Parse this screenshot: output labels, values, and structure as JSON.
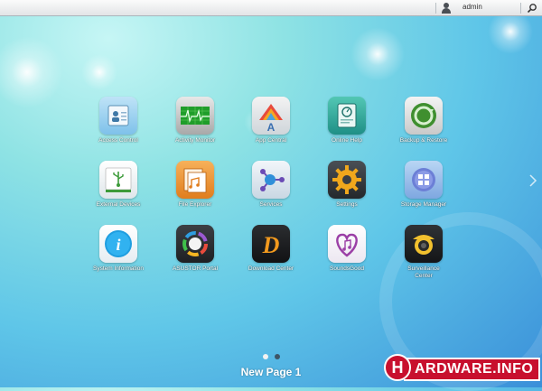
{
  "topbar": {
    "username": "admin",
    "user_icon": "user-icon",
    "search_icon": "search-icon"
  },
  "apps": [
    {
      "label": "Access Control",
      "icon": "access-control-icon"
    },
    {
      "label": "Activity Monitor",
      "icon": "activity-monitor-icon"
    },
    {
      "label": "App Central",
      "icon": "app-central-icon"
    },
    {
      "label": "Online Help",
      "icon": "online-help-icon"
    },
    {
      "label": "Backup & Restore",
      "icon": "backup-restore-icon"
    },
    {
      "label": "External Devices",
      "icon": "external-devices-icon"
    },
    {
      "label": "File Explorer",
      "icon": "file-explorer-icon"
    },
    {
      "label": "Services",
      "icon": "services-icon"
    },
    {
      "label": "Settings",
      "icon": "settings-icon"
    },
    {
      "label": "Storage Manager",
      "icon": "storage-manager-icon"
    },
    {
      "label": "System Information",
      "icon": "system-information-icon"
    },
    {
      "label": "ASUSTOR Portal",
      "icon": "asustor-portal-icon"
    },
    {
      "label": "Download Center",
      "icon": "download-center-icon"
    },
    {
      "label": "SoundsGood",
      "icon": "soundsgood-icon"
    },
    {
      "label": "Surveillance Center",
      "icon": "surveillance-center-icon"
    }
  ],
  "pager": {
    "title": "New Page 1",
    "current_page": 1,
    "total_pages": 2,
    "active_color": "#f2f2f2",
    "inactive_color": "#3d5566"
  },
  "watermark": {
    "logo_letter": "H",
    "text": "ARDWARE.INFO"
  }
}
